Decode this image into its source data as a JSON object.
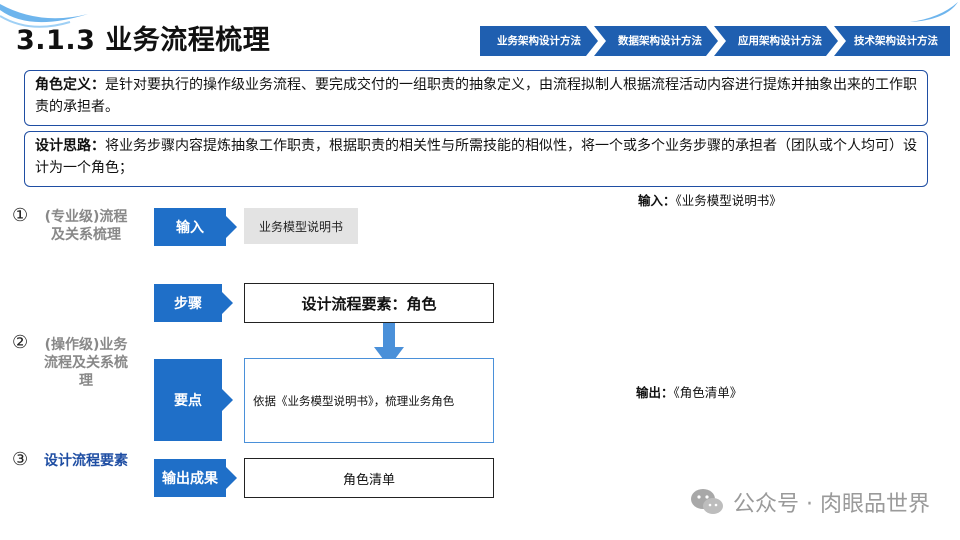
{
  "page": {
    "title": "3.1.3 业务流程梳理"
  },
  "breadcrumb": [
    "业务架构设计方法",
    "数据架构设计方法",
    "应用架构设计方法",
    "技术架构设计方法"
  ],
  "definition": {
    "label": "角色定义：",
    "text": "是针对要执行的操作级业务流程、要完成交付的一组职责的抽象定义，由流程拟制人根据流程活动内容进行提炼并抽象出来的工作职责的承担者。"
  },
  "approach": {
    "label": "设计思路：",
    "text": "将业务步骤内容提炼抽象工作职责，根据职责的相关性与所需技能的相似性，将一个或多个业务步骤的承担者（团队或个人均可）设计为一个角色；"
  },
  "sections": [
    {
      "num": "①",
      "label": "(专业级)流程及关系梳理"
    },
    {
      "num": "②",
      "label": "(操作级)业务流程及关系梳理"
    },
    {
      "num": "③",
      "label": "设计流程要素"
    }
  ],
  "flow": {
    "input_btn": "输入",
    "input_value": "业务模型说明书",
    "steps_btn": "步骤",
    "steps_value": "设计流程要素：角色",
    "key_btn": "要点",
    "key_value": "依据《业务模型说明书》，梳理业务角色",
    "output_btn": "输出成果",
    "output_value": "角色清单"
  },
  "notes": {
    "input_label": "输入：",
    "input_value": "《业务模型说明书》",
    "output_label": "输出：",
    "output_value": "《角色清单》"
  },
  "watermark": {
    "text": "公众号 · 肉眼品世界"
  },
  "colors": {
    "primary_blue": "#1f6fc8",
    "dark_blue": "#1f4ea3",
    "crumb_blue": "#1f5fb0",
    "gray_box": "#e3e3e3"
  }
}
